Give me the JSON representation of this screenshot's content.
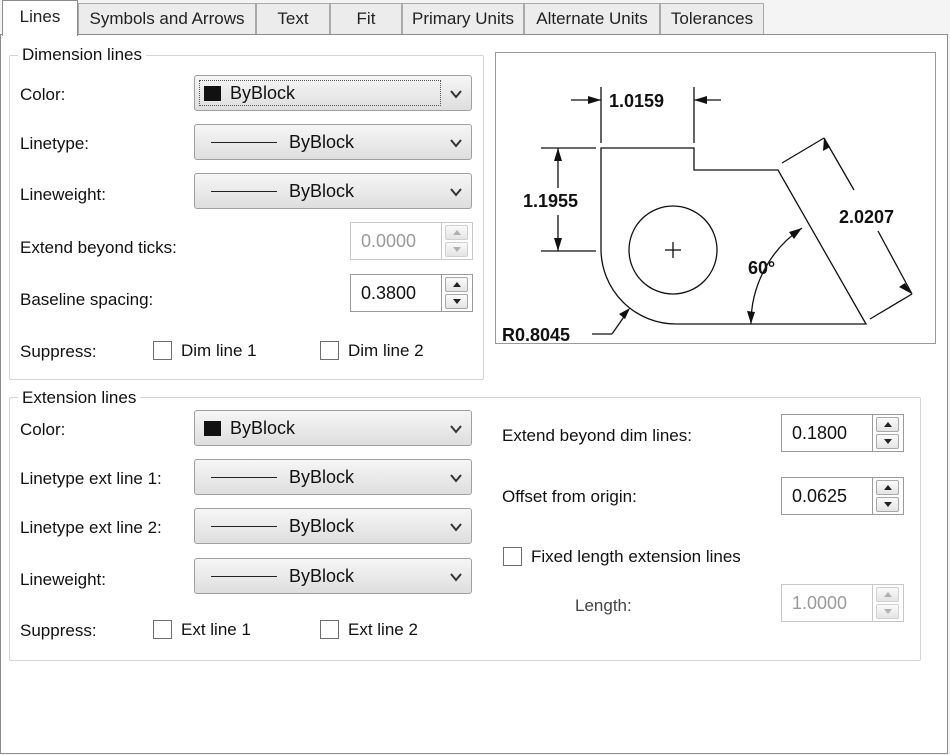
{
  "tabs": [
    {
      "label": "Lines",
      "active": true
    },
    {
      "label": "Symbols and Arrows"
    },
    {
      "label": "Text"
    },
    {
      "label": "Fit"
    },
    {
      "label": "Primary Units"
    },
    {
      "label": "Alternate Units"
    },
    {
      "label": "Tolerances"
    }
  ],
  "dimension_lines": {
    "legend": "Dimension lines",
    "color_label": "Color:",
    "color_value": "ByBlock",
    "linetype_label": "Linetype:",
    "linetype_value": "ByBlock",
    "lineweight_label": "Lineweight:",
    "lineweight_value": "ByBlock",
    "extend_label": "Extend beyond ticks:",
    "extend_value": "0.0000",
    "baseline_label": "Baseline spacing:",
    "baseline_value": "0.3800",
    "suppress_label": "Suppress:",
    "suppress_1": "Dim line 1",
    "suppress_2": "Dim line 2"
  },
  "extension_lines": {
    "legend": "Extension lines",
    "color_label": "Color:",
    "color_value": "ByBlock",
    "linetype1_label": "Linetype ext line 1:",
    "linetype1_value": "ByBlock",
    "linetype2_label": "Linetype ext line 2:",
    "linetype2_value": "ByBlock",
    "lineweight_label": "Lineweight:",
    "lineweight_value": "ByBlock",
    "suppress_label": "Suppress:",
    "suppress_1": "Ext line 1",
    "suppress_2": "Ext line 2",
    "extend_dim_label": "Extend beyond dim lines:",
    "extend_dim_value": "0.1800",
    "offset_label": "Offset from origin:",
    "offset_value": "0.0625",
    "fixed_label": "Fixed length extension lines",
    "length_label": "Length:",
    "length_value": "1.0000"
  },
  "preview": {
    "dim_top": "1.0159",
    "dim_left": "1.1955",
    "dim_right": "2.0207",
    "angle": "60°",
    "radius": "R0.8045"
  },
  "colors": {
    "swatch": "#111111",
    "panel_bg": "#ffffff",
    "tab_bg": "#ececec"
  }
}
